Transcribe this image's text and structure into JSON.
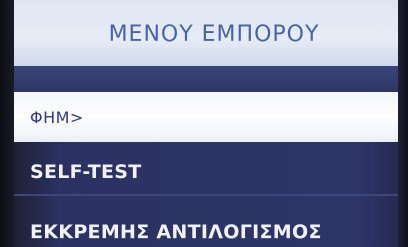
{
  "header": {
    "title": "ΜΕΝΟΥ ΕΜΠΟΡΟΥ"
  },
  "menu": {
    "items": [
      {
        "label": "ΦΗΜ>",
        "selected": true
      },
      {
        "label": "SELF-TEST",
        "selected": false
      },
      {
        "label": "ΕΚΚΡΕΜΗΣ ΑΝΤΙΛΟΓΙΣΜΟΣ",
        "selected": false
      }
    ]
  },
  "colors": {
    "title_bg": "#e3e9f4",
    "title_text": "#4a63a6",
    "screen_bg": "#2d3568",
    "selected_bg": "#ffffff",
    "selected_text": "#2e3a7a",
    "item_text": "#f2f3f8"
  }
}
